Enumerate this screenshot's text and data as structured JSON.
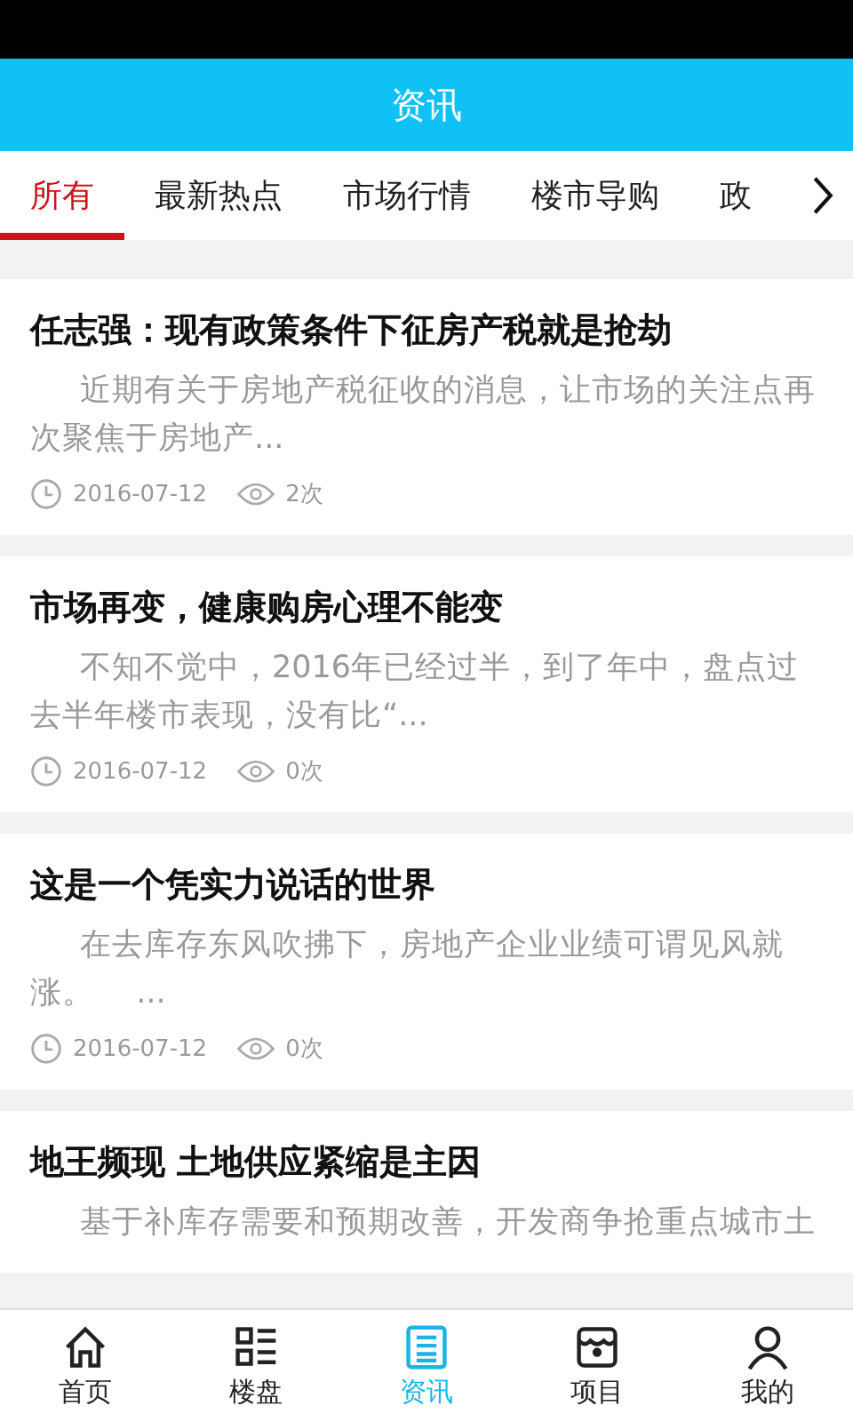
{
  "header": {
    "title": "资讯"
  },
  "tabs": [
    {
      "label": "所有",
      "selected": true
    },
    {
      "label": "最新热点",
      "selected": false
    },
    {
      "label": "市场行情",
      "selected": false
    },
    {
      "label": "楼市导购",
      "selected": false
    },
    {
      "label": "政",
      "selected": false
    }
  ],
  "articles": [
    {
      "title": "任志强：现有政策条件下征房产税就是抢劫",
      "summary": "近期有关于房地产税征收的消息，让市场的关注点再次聚焦于房地产...",
      "date": "2016-07-12",
      "views": "2次"
    },
    {
      "title": "市场再变，健康购房心理不能变",
      "summary": "不知不觉中，2016年已经过半，到了年中，盘点过去半年楼市表现，没有比“...",
      "date": "2016-07-12",
      "views": "0次"
    },
    {
      "title": "这是一个凭实力说话的世界",
      "summary": "在去库存东风吹拂下，房地产企业业绩可谓见风就涨。　 ...",
      "date": "2016-07-12",
      "views": "0次"
    },
    {
      "title": "地王频现 土地供应紧缩是主因",
      "summary": "基于补库存需要和预期改善，开发商争抢重点城市土"
    }
  ],
  "bottom_nav": [
    {
      "label": "首页",
      "selected": false
    },
    {
      "label": "楼盘",
      "selected": false
    },
    {
      "label": "资讯",
      "selected": true
    },
    {
      "label": "项目",
      "selected": false
    },
    {
      "label": "我的",
      "selected": false
    }
  ]
}
